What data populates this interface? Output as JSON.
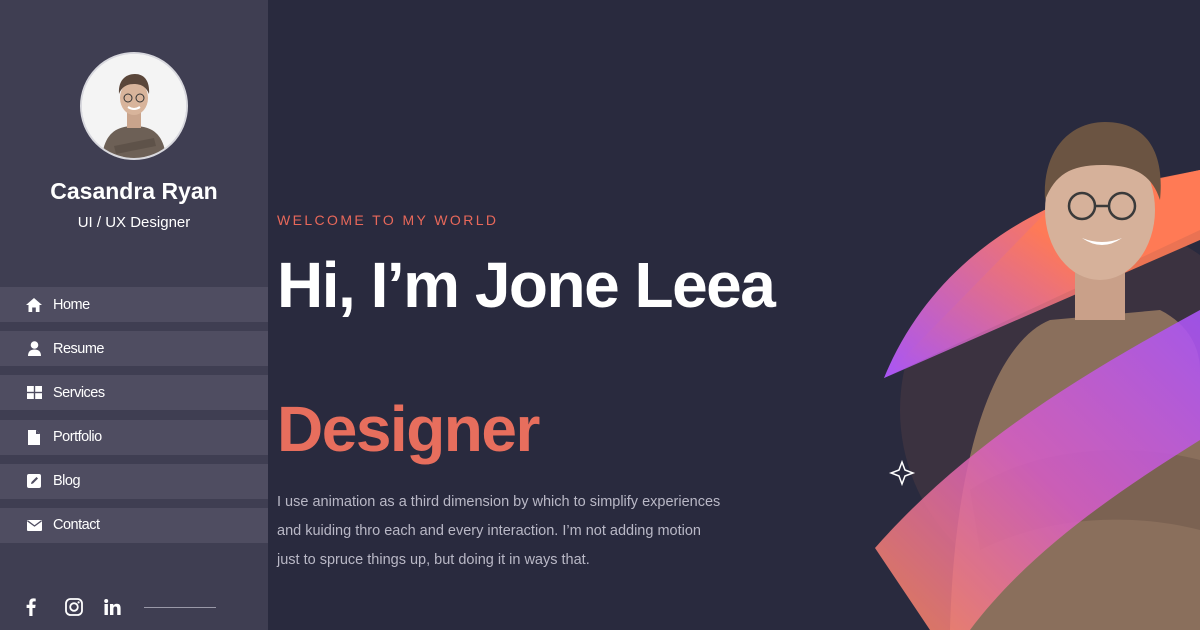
{
  "sidebar": {
    "profile": {
      "name": "Casandra Ryan",
      "role": "UI / UX Designer",
      "avatar_icon": "person-photo"
    },
    "nav": [
      {
        "label": "Home",
        "icon": "home-icon"
      },
      {
        "label": "Resume",
        "icon": "user-icon"
      },
      {
        "label": "Services",
        "icon": "grid-icon"
      },
      {
        "label": "Portfolio",
        "icon": "document-icon"
      },
      {
        "label": "Blog",
        "icon": "edit-icon"
      },
      {
        "label": "Contact",
        "icon": "envelope-icon"
      }
    ],
    "social": [
      {
        "icon": "facebook-icon"
      },
      {
        "icon": "instagram-icon"
      },
      {
        "icon": "linkedin-icon"
      }
    ]
  },
  "hero": {
    "eyebrow": "WELCOME TO MY WORLD",
    "title": "Hi, I’m Jone Leea",
    "accent": "Designer",
    "description": "I use animation as a third dimension by which to simplify experiences and kuiding thro each and every interaction. I’m not adding motion just to spruce things up, but doing it in ways that."
  },
  "colors": {
    "background": "#292a3e",
    "sidebar": "#3f3e52",
    "nav_item": "#4f4d61",
    "accent": "#e76e5d",
    "gradient_start": "#ff7a55",
    "gradient_end": "#a855f7"
  }
}
